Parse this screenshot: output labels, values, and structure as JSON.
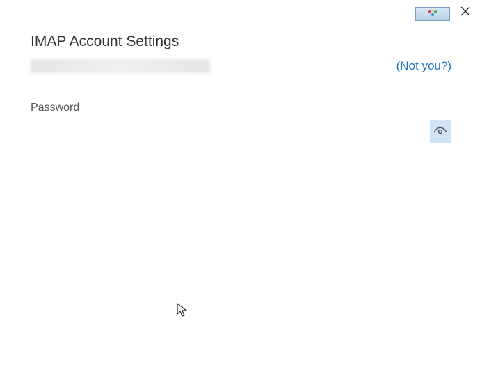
{
  "window": {
    "close_label": "Close"
  },
  "header": {
    "title": "IMAP Account Settings",
    "email_redacted": true,
    "not_you_link": "(Not you?)"
  },
  "form": {
    "password_label": "Password",
    "password_value": "",
    "password_placeholder": "",
    "show_password_label": "Show password"
  },
  "colors": {
    "accent": "#1e74c4",
    "input_border": "#3b8dd6",
    "eye_bg": "#cfe3f4"
  }
}
